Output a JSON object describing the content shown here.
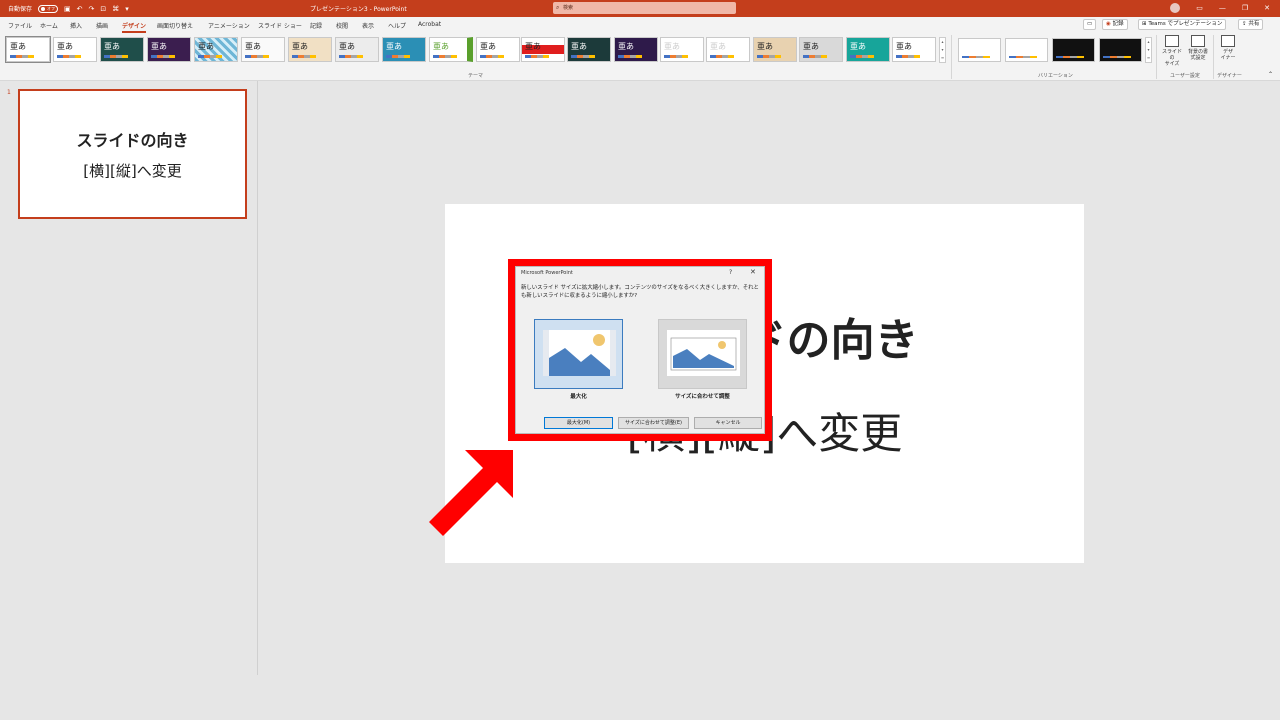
{
  "titlebar": {
    "autosave_label": "自動保存",
    "autosave_state": "オフ",
    "document_title": "プレゼンテーション3  -  PowerPoint",
    "search_placeholder": "検索"
  },
  "tabs": [
    "ファイル",
    "ホーム",
    "挿入",
    "描画",
    "デザイン",
    "画面切り替え",
    "アニメーション",
    "スライド ショー",
    "記録",
    "校閲",
    "表示",
    "ヘルプ",
    "Acrobat"
  ],
  "active_tab": "デザイン",
  "ribbon_right_buttons": {
    "record": "記録",
    "teams": "Teams でプレゼンテーション",
    "share": "共有"
  },
  "ribbon": {
    "theme_glyph": "亜あ",
    "themes_group_label": "テーマ",
    "variations_group_label": "バリエーション",
    "slide_size_label": "スライドの\nサイズ",
    "format_bg_label": "背景の書\n式設定",
    "user_settings_label": "ユーザー設定",
    "designer_label": "デザ\nイナー",
    "designer_group_label": "デザイナー"
  },
  "thumbnail": {
    "number": "1",
    "title": "スライドの向き",
    "subtitle": "[横][縦]へ変更"
  },
  "slide": {
    "title": "スライドの向き",
    "subtitle": "[横][縦]へ変更"
  },
  "dialog": {
    "title": "Microsoft PowerPoint",
    "help": "?",
    "close": "✕",
    "message": "新しいスライド サイズに拡大縮小します。コンテンツのサイズをなるべく大きくしますか、それとも新しいスライドに収まるように縮小しますか?",
    "option_maximize": "最大化",
    "option_fit": "サイズに合わせて調整",
    "btn_maximize": "最大化(M)",
    "btn_fit": "サイズに合わせて調整(E)",
    "btn_cancel": "キャンセル"
  },
  "colors": {
    "accent": "#c43e1c",
    "highlight": "#ff0000"
  }
}
